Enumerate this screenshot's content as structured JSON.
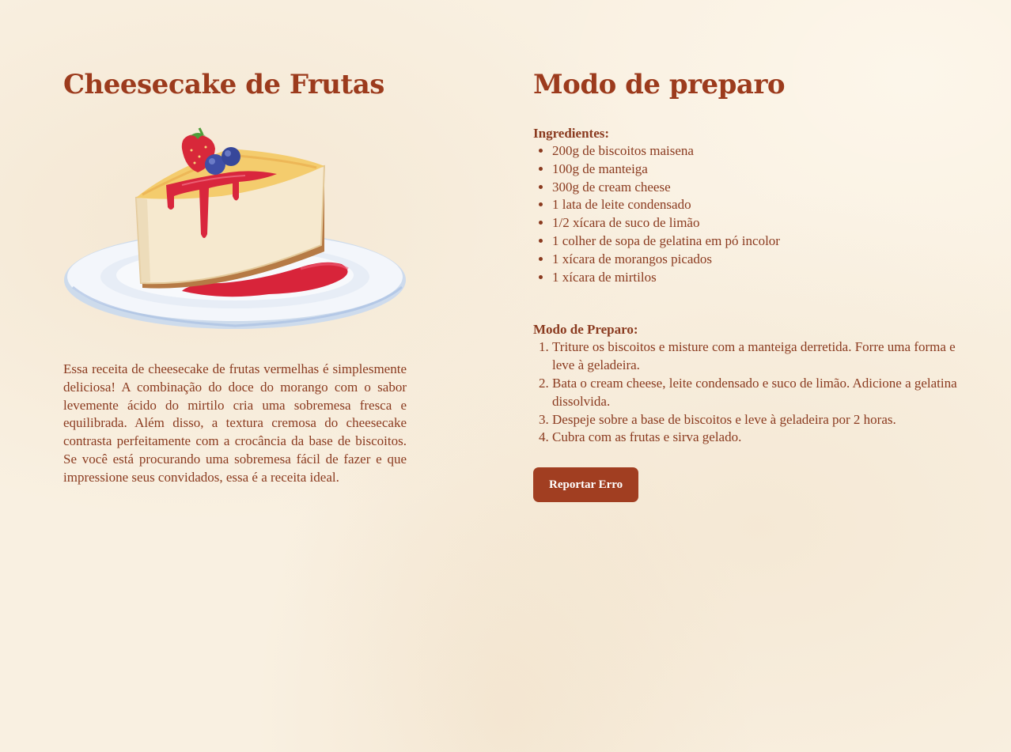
{
  "recipe": {
    "title": "Cheesecake de Frutas",
    "description": "Essa receita de cheesecake de frutas vermelhas é simplesmente deliciosa! A combinação do doce do morango com o sabor levemente ácido do mirtilo cria uma sobremesa fresca e equilibrada. Além disso, a textura cremosa do cheesecake contrasta perfeitamente com a crocância da base de biscoitos. Se você está procurando uma sobremesa fácil de fazer e que impressione seus convidados, essa é a receita ideal."
  },
  "preparation": {
    "title": "Modo de preparo",
    "ingredients_label": "Ingredientes:",
    "ingredients": [
      "200g de biscoitos maisena",
      "100g de manteiga",
      "300g de cream cheese",
      "1 lata de leite condensado",
      "1/2 xícara de suco de limão",
      "1 colher de sopa de gelatina em pó incolor",
      "1 xícara de morangos picados",
      "1 xícara de mirtilos"
    ],
    "steps_label": "Modo de Preparo:",
    "steps": [
      "Triture os biscoitos e misture com a manteiga derretida. Forre uma forma e leve à geladeira.",
      "Bata o cream cheese, leite condensado e suco de limão. Adicione a gelatina dissolvida.",
      "Despeje sobre a base de biscoitos e leve à geladeira por 2 horas.",
      "Cubra com as frutas e sirva gelado."
    ],
    "report_button": "Reportar Erro"
  },
  "colors": {
    "heading": "#9c3b1d",
    "text": "#8a3a1f",
    "button": "#a13e21",
    "background": "#f9f0e1"
  },
  "icons": {
    "cake_image": "cheesecake-slice-illustration"
  }
}
